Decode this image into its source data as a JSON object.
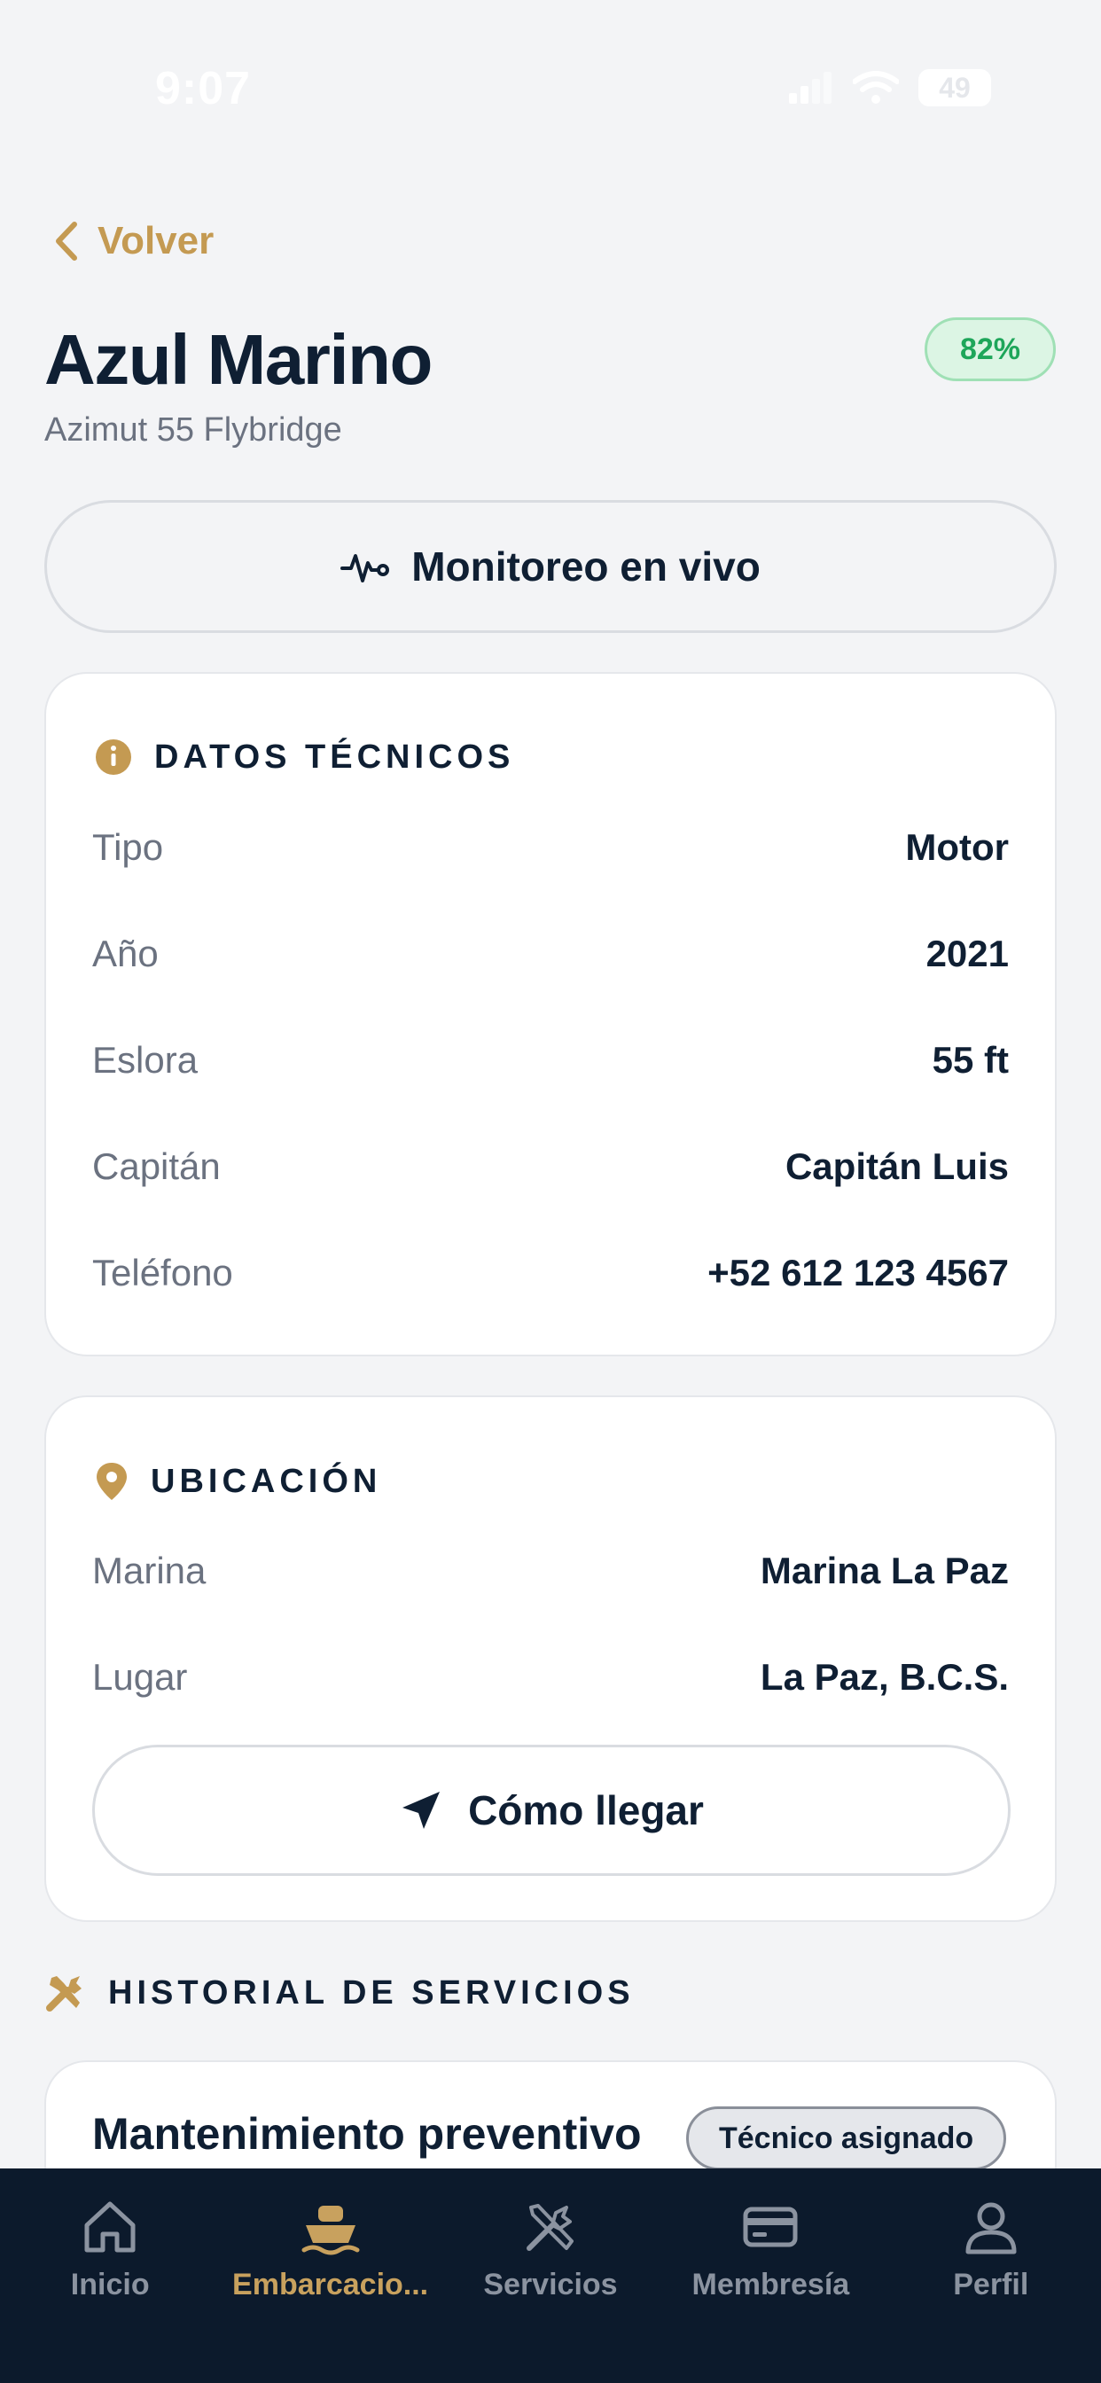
{
  "status_bar": {
    "time": "9:07",
    "battery": "49"
  },
  "nav": {
    "back_label": "Volver"
  },
  "vessel": {
    "name": "Azul Marino",
    "model": "Azimut 55 Flybridge",
    "battery_badge": "82%"
  },
  "live_monitor": {
    "label": "Monitoreo en vivo"
  },
  "technical": {
    "title": "DATOS TÉCNICOS",
    "rows": [
      {
        "label": "Tipo",
        "value": "Motor"
      },
      {
        "label": "Año",
        "value": "2021"
      },
      {
        "label": "Eslora",
        "value": "55 ft"
      },
      {
        "label": "Capitán",
        "value": "Capitán Luis"
      },
      {
        "label": "Teléfono",
        "value": "+52 612 123 4567"
      }
    ]
  },
  "location": {
    "title": "UBICACIÓN",
    "rows": [
      {
        "label": "Marina",
        "value": "Marina La Paz"
      },
      {
        "label": "Lugar",
        "value": "La Paz, B.C.S."
      }
    ],
    "directions_label": "Cómo llegar"
  },
  "history": {
    "title": "HISTORIAL DE SERVICIOS",
    "items": [
      {
        "title": "Mantenimiento preventivo de rutina",
        "status": "Técnico asignado"
      }
    ]
  },
  "tabs": [
    {
      "label": "Inicio",
      "icon": "home-icon"
    },
    {
      "label": "Embarcacio...",
      "icon": "boat-icon",
      "active": true
    },
    {
      "label": "Servicios",
      "icon": "tools-icon"
    },
    {
      "label": "Membresía",
      "icon": "card-icon"
    },
    {
      "label": "Perfil",
      "icon": "user-icon"
    }
  ],
  "colors": {
    "accent": "#c49a52",
    "navy": "#0f1f33",
    "success": "#1ea65a",
    "tab_bar": "#0c1a2c"
  }
}
